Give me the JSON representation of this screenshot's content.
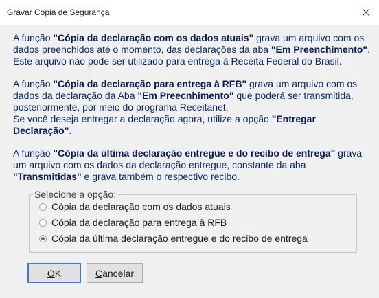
{
  "window": {
    "title": "Gravar Cópia de Segurança"
  },
  "paragraphs": [
    [
      {
        "t": "A função ",
        "b": false
      },
      {
        "t": "\"Cópia da declaração com os dados atuais\"",
        "b": true
      },
      {
        "t": " grava um arquivo com os dados preenchidos até o momento, das declarações da aba ",
        "b": false
      },
      {
        "t": "\"Em Preenchimento\"",
        "b": true
      },
      {
        "t": ". Este arquivo não pode ser utilizado para entrega à Receita Federal do Brasil.",
        "b": false
      }
    ],
    [
      {
        "t": "A função ",
        "b": false
      },
      {
        "t": "\"Cópia da declaração para entrega à RFB\"",
        "b": true
      },
      {
        "t": " grava um arquivo com os dados da declaração da Aba ",
        "b": false
      },
      {
        "t": "\"Em Preecnhimento\"",
        "b": true
      },
      {
        "t": " que poderá ser transmitida, posteriormente, por meio do programa Receitanet.",
        "b": false
      },
      {
        "t": "\n",
        "b": false
      },
      {
        "t": "Se você deseja entregar a declaração agora, utilize a opção ",
        "b": false
      },
      {
        "t": "\"Entregar Declaração\"",
        "b": true
      },
      {
        "t": ".",
        "b": false
      }
    ],
    [
      {
        "t": "A função ",
        "b": false
      },
      {
        "t": "\"Cópia da última declaração entregue e do recibo de entrega\"",
        "b": true
      },
      {
        "t": " grava um arquivo com os dados da declaração entregue, constante da aba ",
        "b": false
      },
      {
        "t": "\"Transmitidas\"",
        "b": true
      },
      {
        "t": " e grava também o respectivo recibo.",
        "b": false
      }
    ]
  ],
  "options": {
    "legend": "Selecione a opção:",
    "items": [
      {
        "label": "Cópia da declaração com os dados atuais",
        "selected": false
      },
      {
        "label": "Cópia da declaração para entrega à RFB",
        "selected": false
      },
      {
        "label": "Cópia da última declaração entregue e do recibo de entrega",
        "selected": true
      }
    ]
  },
  "buttons": {
    "ok": {
      "mnemonic": "O",
      "rest": "K"
    },
    "cancel": {
      "mnemonic": "C",
      "rest": "ancelar"
    }
  },
  "colors": {
    "text_blue": "#0a2a6b",
    "radio_selected": "#2a76c9",
    "default_button_border": "#3d78d4"
  }
}
